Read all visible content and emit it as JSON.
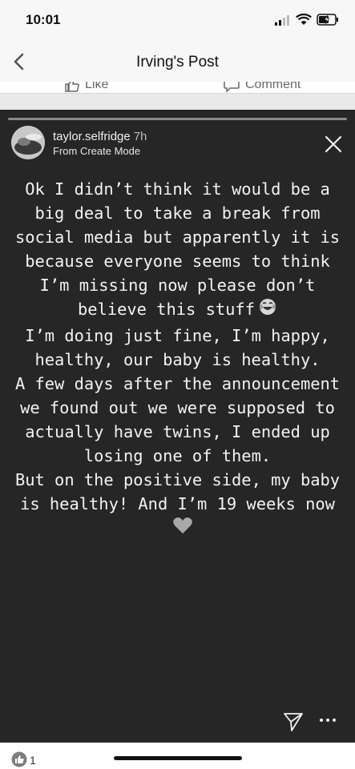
{
  "status_bar": {
    "time": "10:01"
  },
  "nav": {
    "title": "Irving's Post"
  },
  "post_actions": {
    "like_label": "Like",
    "comment_label": "Comment"
  },
  "story": {
    "username": "taylor.selfridge",
    "time_ago": "7h",
    "subtitle": "From Create Mode",
    "paragraphs": [
      "Ok I didn’t think it would be a big deal to take a break from social media but apparently it is because everyone seems to think I’m missing now please don’t believe this stuff",
      "I’m doing just fine, I’m happy, healthy, our baby is healthy.",
      "A few days after the announcement we found out we were supposed to actually have twins, I ended up losing one of them.",
      "But on the positive side, my baby is healthy! And I’m 19 weeks now"
    ],
    "emoji_1": "laughing-tears-emoji",
    "emoji_2": "heart-emoji"
  },
  "footer": {
    "reaction_count": "1"
  },
  "colors": {
    "story_bg": "#262626",
    "story_text": "#f2f2f2",
    "bars_bg": "#f7f7f7"
  }
}
